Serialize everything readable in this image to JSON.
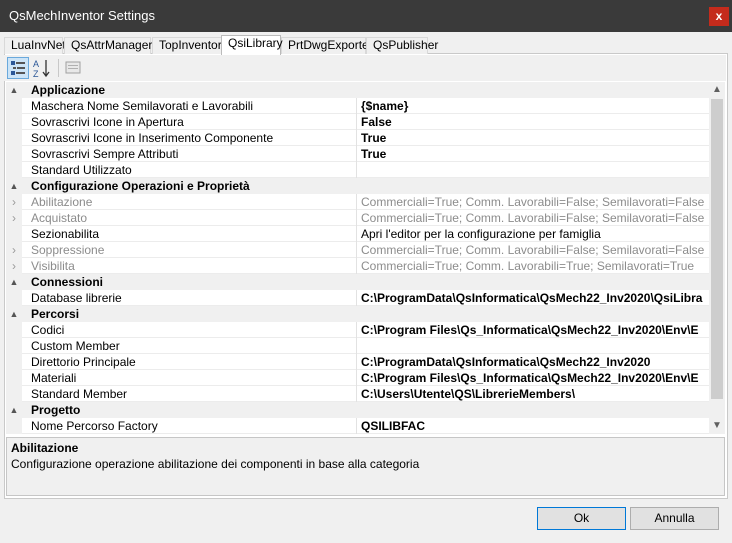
{
  "window": {
    "title": "QsMechInventor Settings",
    "close_glyph": "x"
  },
  "tabs": [
    {
      "label": "LuaInvNet",
      "active": false
    },
    {
      "label": "QsAttrManager",
      "active": false
    },
    {
      "label": "TopInventor",
      "active": false
    },
    {
      "label": "QsiLibrary",
      "active": true
    },
    {
      "label": "PrtDwgExporter",
      "active": false
    },
    {
      "label": "QsPublisher",
      "active": false
    }
  ],
  "toolbar": {
    "icons": [
      "categorized-icon",
      "alphabetical-icon",
      "property-pages-icon"
    ],
    "sort_letters": "A Z"
  },
  "grid": {
    "rows": [
      {
        "kind": "cat",
        "glyph": "▲",
        "label": "Applicazione"
      },
      {
        "kind": "prop",
        "glyph": "",
        "label": "Maschera Nome Semilavorati e Lavorabili",
        "value": "{$name}",
        "bold": true,
        "dim": false
      },
      {
        "kind": "prop",
        "glyph": "",
        "label": "Sovrascrivi Icone in Apertura",
        "value": "False",
        "bold": true,
        "dim": false
      },
      {
        "kind": "prop",
        "glyph": "",
        "label": "Sovrascrivi Icone in Inserimento Componente",
        "value": "True",
        "bold": true,
        "dim": false
      },
      {
        "kind": "prop",
        "glyph": "",
        "label": "Sovrascrivi Sempre Attributi",
        "value": "True",
        "bold": true,
        "dim": false
      },
      {
        "kind": "prop",
        "glyph": "",
        "label": "Standard Utilizzato",
        "value": "",
        "bold": false,
        "dim": false
      },
      {
        "kind": "cat",
        "glyph": "▲",
        "label": "Configurazione Operazioni e Proprietà"
      },
      {
        "kind": "prop",
        "glyph": "›",
        "label": "Abilitazione",
        "value": "Commerciali=True; Comm. Lavorabili=False; Semilavorati=False",
        "bold": false,
        "dim": true
      },
      {
        "kind": "prop",
        "glyph": "›",
        "label": "Acquistato",
        "value": "Commerciali=True; Comm. Lavorabili=False; Semilavorati=False",
        "bold": false,
        "dim": true
      },
      {
        "kind": "prop",
        "glyph": "",
        "label": "Sezionabilita",
        "value": "Apri l'editor per la configurazione per famiglia",
        "bold": false,
        "dim": false
      },
      {
        "kind": "prop",
        "glyph": "›",
        "label": "Soppressione",
        "value": "Commerciali=True; Comm. Lavorabili=False; Semilavorati=False",
        "bold": false,
        "dim": true
      },
      {
        "kind": "prop",
        "glyph": "›",
        "label": "Visibilita",
        "value": "Commerciali=True; Comm. Lavorabili=True; Semilavorati=True",
        "bold": false,
        "dim": true
      },
      {
        "kind": "cat",
        "glyph": "▲",
        "label": "Connessioni"
      },
      {
        "kind": "prop",
        "glyph": "",
        "label": "Database librerie",
        "value": "C:\\ProgramData\\QsInformatica\\QsMech22_Inv2020\\QsiLibra",
        "bold": true,
        "dim": false
      },
      {
        "kind": "cat",
        "glyph": "▲",
        "label": "Percorsi"
      },
      {
        "kind": "prop",
        "glyph": "",
        "label": "Codici",
        "value": "C:\\Program Files\\Qs_Informatica\\QsMech22_Inv2020\\Env\\E",
        "bold": true,
        "dim": false
      },
      {
        "kind": "prop",
        "glyph": "",
        "label": "Custom Member",
        "value": "",
        "bold": false,
        "dim": false
      },
      {
        "kind": "prop",
        "glyph": "",
        "label": "Direttorio Principale",
        "value": "C:\\ProgramData\\QsInformatica\\QsMech22_Inv2020",
        "bold": true,
        "dim": false
      },
      {
        "kind": "prop",
        "glyph": "",
        "label": "Materiali",
        "value": "C:\\Program Files\\Qs_Informatica\\QsMech22_Inv2020\\Env\\E",
        "bold": true,
        "dim": false
      },
      {
        "kind": "prop",
        "glyph": "",
        "label": "Standard Member",
        "value": "C:\\Users\\Utente\\QS\\LibrerieMembers\\",
        "bold": true,
        "dim": false
      },
      {
        "kind": "cat",
        "glyph": "▲",
        "label": "Progetto"
      },
      {
        "kind": "prop",
        "glyph": "",
        "label": "Nome Percorso Factory",
        "value": "QSILIBFAC",
        "bold": true,
        "dim": false
      }
    ]
  },
  "scrollbar": {
    "up": "▲",
    "down": "▼"
  },
  "description": {
    "title": "Abilitazione",
    "text": "Configurazione operazione abilitazione dei componenti in base alla categoria"
  },
  "buttons": {
    "ok": "Ok",
    "cancel": "Annulla"
  }
}
